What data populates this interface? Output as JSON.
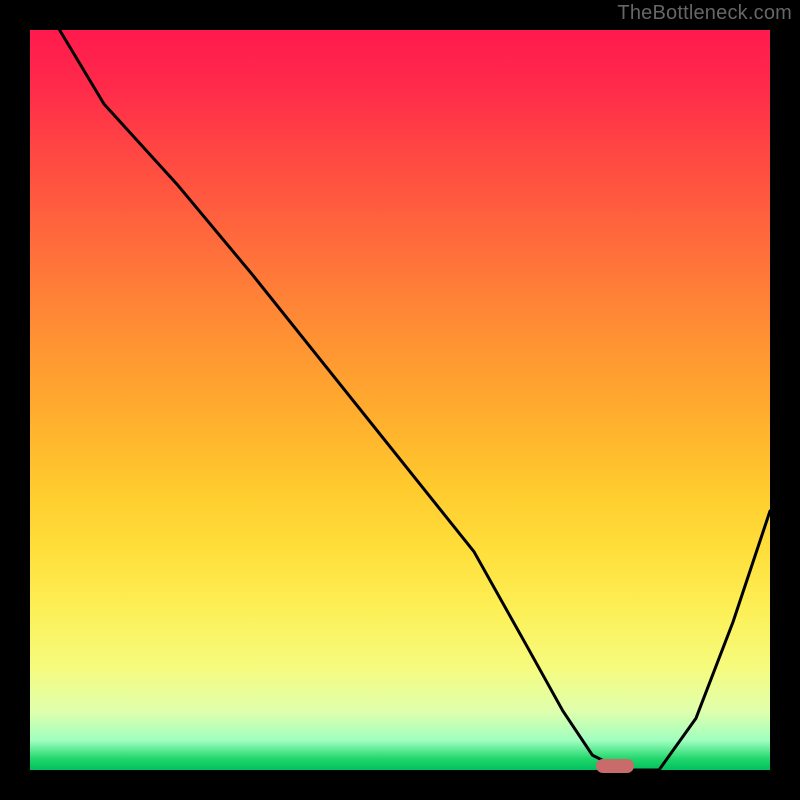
{
  "watermark": "TheBottleneck.com",
  "chart_data": {
    "type": "line",
    "title": "",
    "xlabel": "",
    "ylabel": "",
    "xlim": [
      0,
      100
    ],
    "ylim": [
      0,
      100
    ],
    "grid": false,
    "series": [
      {
        "name": "bottleneck-curve",
        "x": [
          4,
          10,
          20,
          30,
          40,
          50,
          60,
          67,
          72,
          76,
          80,
          85,
          90,
          95,
          100
        ],
        "y": [
          100,
          90,
          79,
          67,
          54.5,
          42,
          29.5,
          17,
          8,
          2,
          0,
          0,
          7,
          20,
          35
        ]
      }
    ],
    "marker": {
      "name": "optimal-point",
      "x": 79,
      "y": 0,
      "color": "#c96b6b"
    },
    "background_gradient": {
      "top": "#ff1a4d",
      "mid": "#ffb62d",
      "bottom": "#00c060"
    }
  }
}
